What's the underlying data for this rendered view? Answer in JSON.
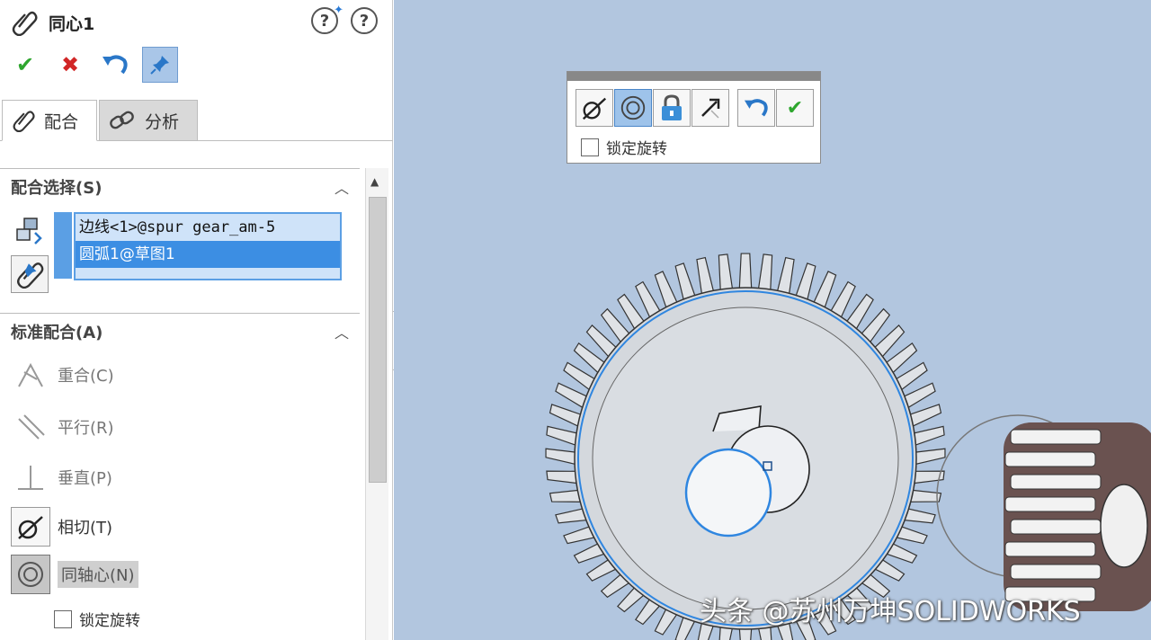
{
  "panel": {
    "title": "同心1",
    "help_label": "?",
    "tabs": [
      {
        "label": "配合"
      },
      {
        "label": "分析"
      }
    ],
    "sections": {
      "selections": {
        "label": "配合选择(S)"
      },
      "standard": {
        "label": "标准配合(A)"
      }
    },
    "selections": [
      "边线<1>@spur gear_am-5",
      "圆弧1@草图1"
    ],
    "standard_mates": [
      {
        "label": "重合(C)"
      },
      {
        "label": "平行(R)"
      },
      {
        "label": "垂直(P)"
      },
      {
        "label": "相切(T)"
      },
      {
        "label": "同轴心(N)"
      }
    ],
    "lock_rotation_label": "锁定旋转"
  },
  "mini_toolbar": {
    "lock_rotation_label": "锁定旋转"
  },
  "watermark": "头条 @苏州万坤SOLIDWORKS",
  "colors": {
    "viewport_bg": "#b2c6df",
    "accent_blue": "#3c8ee3",
    "ok_green": "#2ea62e",
    "cancel_red": "#d12626"
  }
}
